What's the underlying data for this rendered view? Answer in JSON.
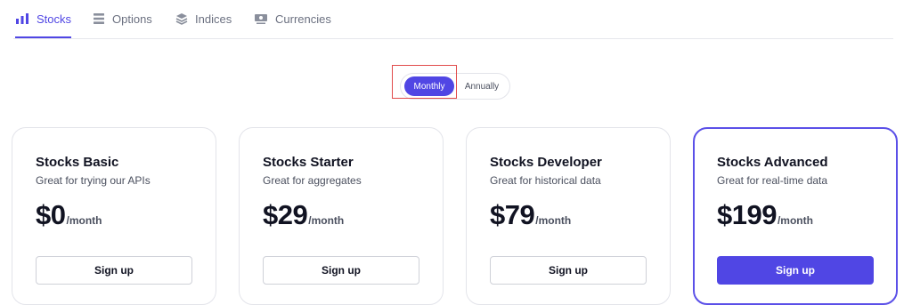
{
  "tabs": [
    {
      "label": "Stocks",
      "icon": "bar-chart-icon",
      "active": true
    },
    {
      "label": "Options",
      "icon": "list-icon",
      "active": false
    },
    {
      "label": "Indices",
      "icon": "layers-icon",
      "active": false
    },
    {
      "label": "Currencies",
      "icon": "currency-icon",
      "active": false
    }
  ],
  "billing_toggle": {
    "monthly_label": "Monthly",
    "annually_label": "Annually",
    "selected": "Monthly"
  },
  "plans": [
    {
      "name": "Stocks Basic",
      "description": "Great for trying our APIs",
      "price": "$0",
      "period": "/month",
      "button": "Sign up",
      "featured": false
    },
    {
      "name": "Stocks Starter",
      "description": "Great for aggregates",
      "price": "$29",
      "period": "/month",
      "button": "Sign up",
      "featured": false
    },
    {
      "name": "Stocks Developer",
      "description": "Great for historical data",
      "price": "$79",
      "period": "/month",
      "button": "Sign up",
      "featured": false
    },
    {
      "name": "Stocks Advanced",
      "description": "Great for real-time data",
      "price": "$199",
      "period": "/month",
      "button": "Sign up",
      "featured": true
    }
  ],
  "colors": {
    "accent": "#5046e4",
    "highlight": "#e14b4b",
    "text": "#111322",
    "muted": "#4a4f5e"
  }
}
